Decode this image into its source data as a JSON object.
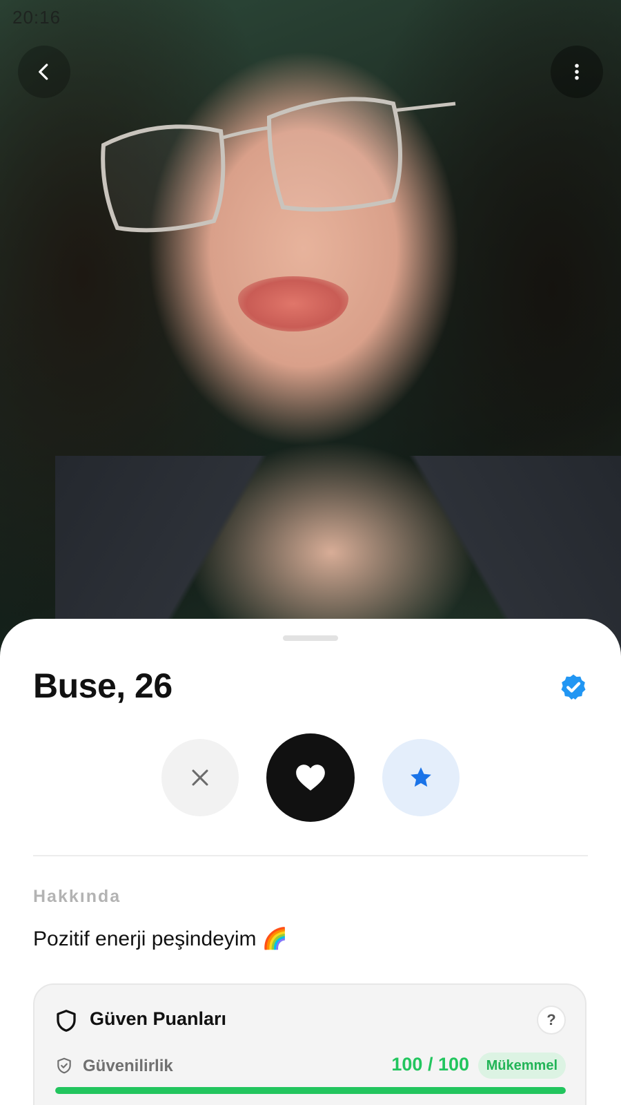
{
  "status_bar": {
    "time": "20:16"
  },
  "top_bar": {
    "back_icon": "chevron-left-icon",
    "more_icon": "more-vertical-icon"
  },
  "profile": {
    "name_age": "Buse, 26",
    "verified": true,
    "verified_color": "#2196F3"
  },
  "actions": {
    "dislike_icon": "close-icon",
    "like_icon": "heart-icon",
    "superlike_icon": "star-icon",
    "superlike_color": "#1a73e8"
  },
  "about": {
    "title": "Hakkında",
    "bio": "Pozitif enerji peşindeyim 🌈"
  },
  "trust": {
    "title": "Güven Puanları",
    "help_label": "?",
    "metrics": [
      {
        "label": "Güvenilirlik",
        "value": "100 / 100",
        "badge": "Mükemmel",
        "progress": 1.0,
        "color": "#22c55e"
      }
    ]
  }
}
